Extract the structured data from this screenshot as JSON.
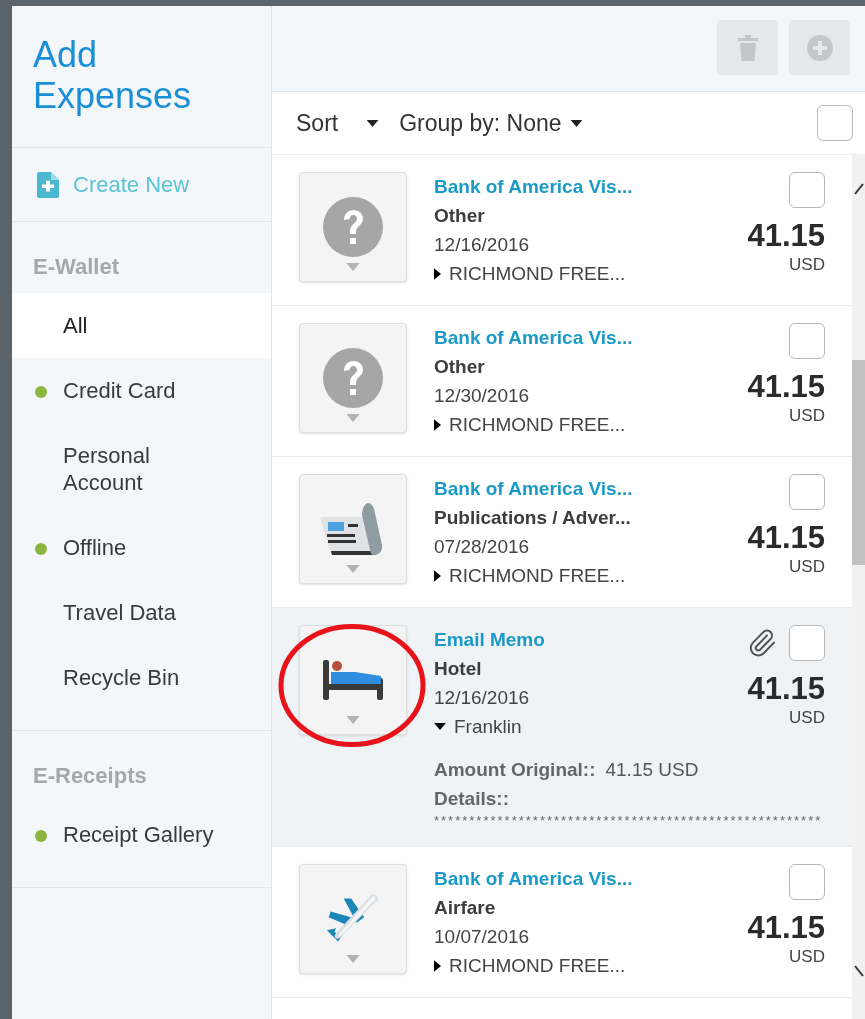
{
  "sidebar": {
    "title": "Add Expenses",
    "create_new": "Create New",
    "sections": [
      {
        "heading": "E-Wallet",
        "items": [
          {
            "label": "All",
            "selected": true,
            "dot": false
          },
          {
            "label": "Credit Card",
            "selected": false,
            "dot": true
          },
          {
            "label": "Personal Account",
            "selected": false,
            "dot": false
          },
          {
            "label": "Offline",
            "selected": false,
            "dot": true
          },
          {
            "label": "Travel Data",
            "selected": false,
            "dot": false
          },
          {
            "label": "Recycle Bin",
            "selected": false,
            "dot": false
          }
        ]
      },
      {
        "heading": "E-Receipts",
        "items": [
          {
            "label": "Receipt Gallery",
            "selected": false,
            "dot": true
          }
        ]
      }
    ]
  },
  "toolbar": {
    "delete_disabled": true,
    "add_disabled": true
  },
  "list_header": {
    "sort": "Sort",
    "group_by": "Group by: None",
    "select_all_checked": false
  },
  "expenses": [
    {
      "kind": "unknown",
      "title": "Bank of America Vis...",
      "category": "Other",
      "date": "12/16/2016",
      "merchant": "RICHMOND FREE...",
      "amount": "41.15",
      "currency": "USD",
      "checked": false,
      "expanded": false,
      "attachment": false,
      "highlighted": false
    },
    {
      "kind": "unknown",
      "title": "Bank of America Vis...",
      "category": "Other",
      "date": "12/30/2016",
      "merchant": "RICHMOND FREE...",
      "amount": "41.15",
      "currency": "USD",
      "checked": false,
      "expanded": false,
      "attachment": false,
      "highlighted": false
    },
    {
      "kind": "publication",
      "title": "Bank of America Vis...",
      "category": "Publications / Adver...",
      "date": "07/28/2016",
      "merchant": "RICHMOND FREE...",
      "amount": "41.15",
      "currency": "USD",
      "checked": false,
      "expanded": false,
      "attachment": false,
      "highlighted": false
    },
    {
      "kind": "hotel",
      "title": "Email Memo",
      "category": "Hotel",
      "date": "12/16/2016",
      "merchant": "Franklin",
      "amount": "41.15",
      "currency": "USD",
      "checked": false,
      "expanded": true,
      "attachment": true,
      "highlighted": true,
      "details": [
        {
          "label": "Amount Original::",
          "value": "41.15 USD"
        },
        {
          "label": "Details::"
        }
      ],
      "details_text": "*******************************************************"
    },
    {
      "kind": "airfare",
      "title": "Bank of America Vis...",
      "category": "Airfare",
      "date": "10/07/2016",
      "merchant": "RICHMOND FREE...",
      "amount": "41.15",
      "currency": "USD",
      "checked": false,
      "expanded": false,
      "attachment": false,
      "highlighted": false
    }
  ]
}
